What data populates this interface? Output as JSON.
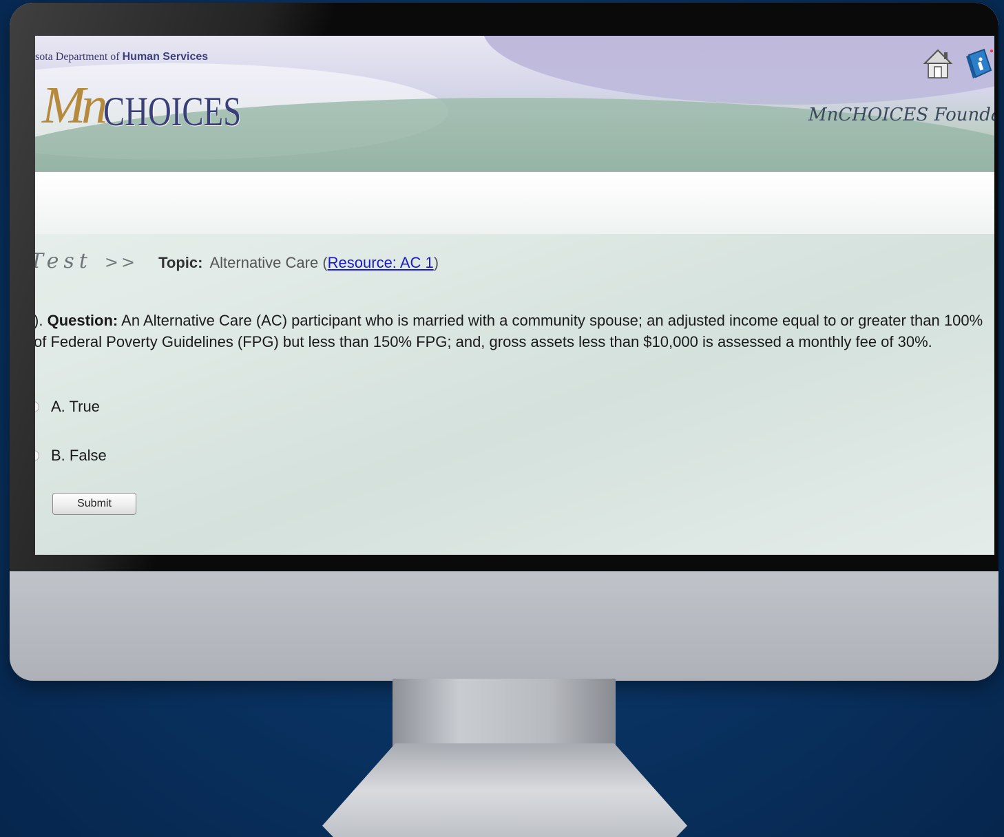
{
  "banner": {
    "dept_prefix": "sota Department of ",
    "dept_bold": "Human Services",
    "logo_mn": "Mn",
    "logo_choices": "CHOICES",
    "tagline": "MnCHOICES Founda",
    "home_icon": "home-icon",
    "info_icon": "info-book-icon"
  },
  "breadcrumb": {
    "test": "Test",
    "arrows": ">>",
    "topic_label": "Topic:",
    "topic_value": "Alternative Care (",
    "resource_link": "Resource: AC 1",
    "topic_close": ")"
  },
  "question": {
    "prefix": ").",
    "label": "Question:",
    "text": "An Alternative Care (AC) participant who is married with a community spouse;  an adjusted income equal to or greater than 100% of Federal Poverty Guidelines (FPG) but less than 150% FPG; and, gross assets less than $10,000 is assessed a monthly fee of 30%."
  },
  "options": [
    {
      "label": "A. True"
    },
    {
      "label": "B. False"
    }
  ],
  "submit_label": "Submit",
  "colors": {
    "background": "#0a3566",
    "logo_gold": "#b58a3c",
    "logo_navy": "#3a3f78",
    "link": "#1a1ac8"
  }
}
